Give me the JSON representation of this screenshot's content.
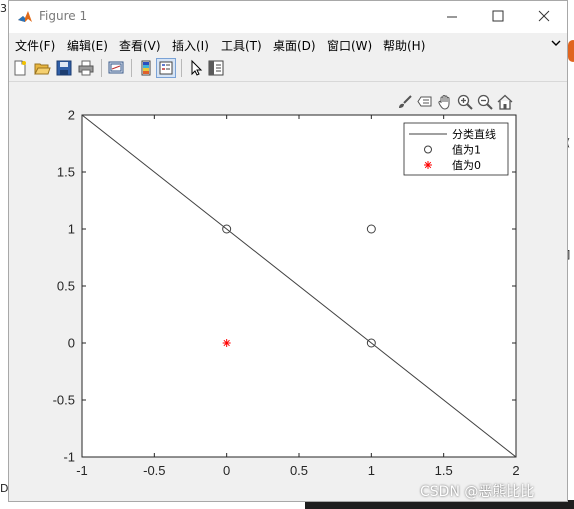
{
  "window": {
    "title": "Figure 1"
  },
  "menu": {
    "items": [
      "文件(F)",
      "编辑(E)",
      "查看(V)",
      "插入(I)",
      "工具(T)",
      "桌面(D)",
      "窗口(W)",
      "帮助(H)"
    ]
  },
  "toolbar": {
    "icons": [
      "new-figure-icon",
      "open-file-icon",
      "save-icon",
      "print-icon",
      "link-plot-icon",
      "insert-colorbar-icon",
      "insert-legend-icon",
      "edit-plot-icon",
      "property-inspector-icon"
    ]
  },
  "axes_toolbar": {
    "icons": [
      "brush-icon",
      "data-tips-icon",
      "pan-icon",
      "zoom-in-icon",
      "zoom-out-icon",
      "home-icon"
    ]
  },
  "chart_data": {
    "type": "scatter",
    "title": "",
    "xlabel": "",
    "ylabel": "",
    "xlim": [
      -1,
      2
    ],
    "ylim": [
      -1,
      2
    ],
    "xticks": [
      "-1",
      "-0.5",
      "0",
      "0.5",
      "1",
      "1.5",
      "2"
    ],
    "yticks": [
      "2",
      "1.5",
      "1",
      "0.5",
      "0",
      "-0.5",
      "-1"
    ],
    "grid": false,
    "legend_position": "top-right",
    "series": [
      {
        "name": "分类直线",
        "kind": "line",
        "color": "#404040",
        "x": [
          -1,
          2
        ],
        "y": [
          2,
          -1
        ]
      },
      {
        "name": "值为1",
        "kind": "marker-circle",
        "color": "#404040",
        "x": [
          0,
          1,
          1
        ],
        "y": [
          1,
          1,
          0
        ]
      },
      {
        "name": "值为0",
        "kind": "marker-asterisk",
        "color": "#ff0000",
        "x": [
          0
        ],
        "y": [
          0
        ]
      }
    ]
  },
  "background": {
    "glyphs": [
      "3",
      "(",
      "D",
      "]"
    ]
  },
  "watermark": "CSDN @恶熊比比"
}
